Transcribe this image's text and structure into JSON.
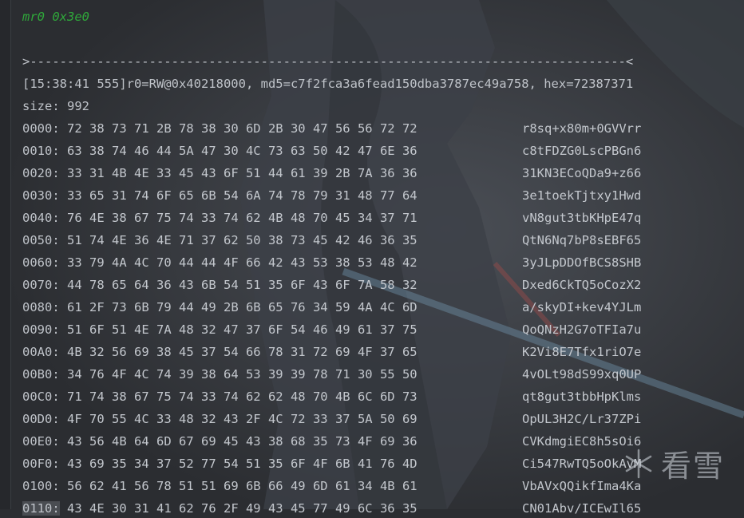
{
  "command": "mr0 0x3e0",
  "separator": ">--------------------------------------------------------------------------------<",
  "info_line": "[15:38:41 555]r0=RW@0x40218000, md5=c7f2fca3a6fead150dba3787ec49a758, hex=72387371",
  "size_line": "size: 992",
  "rows": [
    {
      "addr": "0000:",
      "hex": "72 38 73 71 2B 78 38 30 6D 2B 30 47 56 56 72 72",
      "ascii": "r8sq+x80m+0GVVrr"
    },
    {
      "addr": "0010:",
      "hex": "63 38 74 46 44 5A 47 30 4C 73 63 50 42 47 6E 36",
      "ascii": "c8tFDZG0LscPBGn6"
    },
    {
      "addr": "0020:",
      "hex": "33 31 4B 4E 33 45 43 6F 51 44 61 39 2B 7A 36 36",
      "ascii": "31KN3ECoQDa9+z66"
    },
    {
      "addr": "0030:",
      "hex": "33 65 31 74 6F 65 6B 54 6A 74 78 79 31 48 77 64",
      "ascii": "3e1toekTjtxy1Hwd"
    },
    {
      "addr": "0040:",
      "hex": "76 4E 38 67 75 74 33 74 62 4B 48 70 45 34 37 71",
      "ascii": "vN8gut3tbKHpE47q"
    },
    {
      "addr": "0050:",
      "hex": "51 74 4E 36 4E 71 37 62 50 38 73 45 42 46 36 35",
      "ascii": "QtN6Nq7bP8sEBF65"
    },
    {
      "addr": "0060:",
      "hex": "33 79 4A 4C 70 44 44 4F 66 42 43 53 38 53 48 42",
      "ascii": "3yJLpDDOfBCS8SHB"
    },
    {
      "addr": "0070:",
      "hex": "44 78 65 64 36 43 6B 54 51 35 6F 43 6F 7A 58 32",
      "ascii": "Dxed6CkTQ5oCozX2"
    },
    {
      "addr": "0080:",
      "hex": "61 2F 73 6B 79 44 49 2B 6B 65 76 34 59 4A 4C 6D",
      "ascii": "a/skyDI+kev4YJLm"
    },
    {
      "addr": "0090:",
      "hex": "51 6F 51 4E 7A 48 32 47 37 6F 54 46 49 61 37 75",
      "ascii": "QoQNzH2G7oTFIa7u"
    },
    {
      "addr": "00A0:",
      "hex": "4B 32 56 69 38 45 37 54 66 78 31 72 69 4F 37 65",
      "ascii": "K2Vi8E7Tfx1riO7e"
    },
    {
      "addr": "00B0:",
      "hex": "34 76 4F 4C 74 39 38 64 53 39 39 78 71 30 55 50",
      "ascii": "4vOLt98dS99xq0UP"
    },
    {
      "addr": "00C0:",
      "hex": "71 74 38 67 75 74 33 74 62 62 48 70 4B 6C 6D 73",
      "ascii": "qt8gut3tbbHpKlms"
    },
    {
      "addr": "00D0:",
      "hex": "4F 70 55 4C 33 48 32 43 2F 4C 72 33 37 5A 50 69",
      "ascii": "OpUL3H2C/Lr37ZPi"
    },
    {
      "addr": "00E0:",
      "hex": "43 56 4B 64 6D 67 69 45 43 38 68 35 73 4F 69 36",
      "ascii": "CVKdmgiEC8h5sOi6"
    },
    {
      "addr": "00F0:",
      "hex": "43 69 35 34 37 52 77 54 51 35 6F 4F 6B 41 76 4D",
      "ascii": "Ci547RwTQ5oOkAvM"
    },
    {
      "addr": "0100:",
      "hex": "56 62 41 56 78 51 51 69 6B 66 49 6D 61 34 4B 61",
      "ascii": "VbAVxQQikfIma4Ka"
    },
    {
      "addr": "0110:",
      "hex": "43 4E 30 31 41 62 76 2F 49 43 45 77 49 6C 36 35",
      "ascii": "CN01Abv/ICEwIl65"
    }
  ],
  "watermark": {
    "text": "看雪",
    "icon": "snowflake-icon"
  }
}
